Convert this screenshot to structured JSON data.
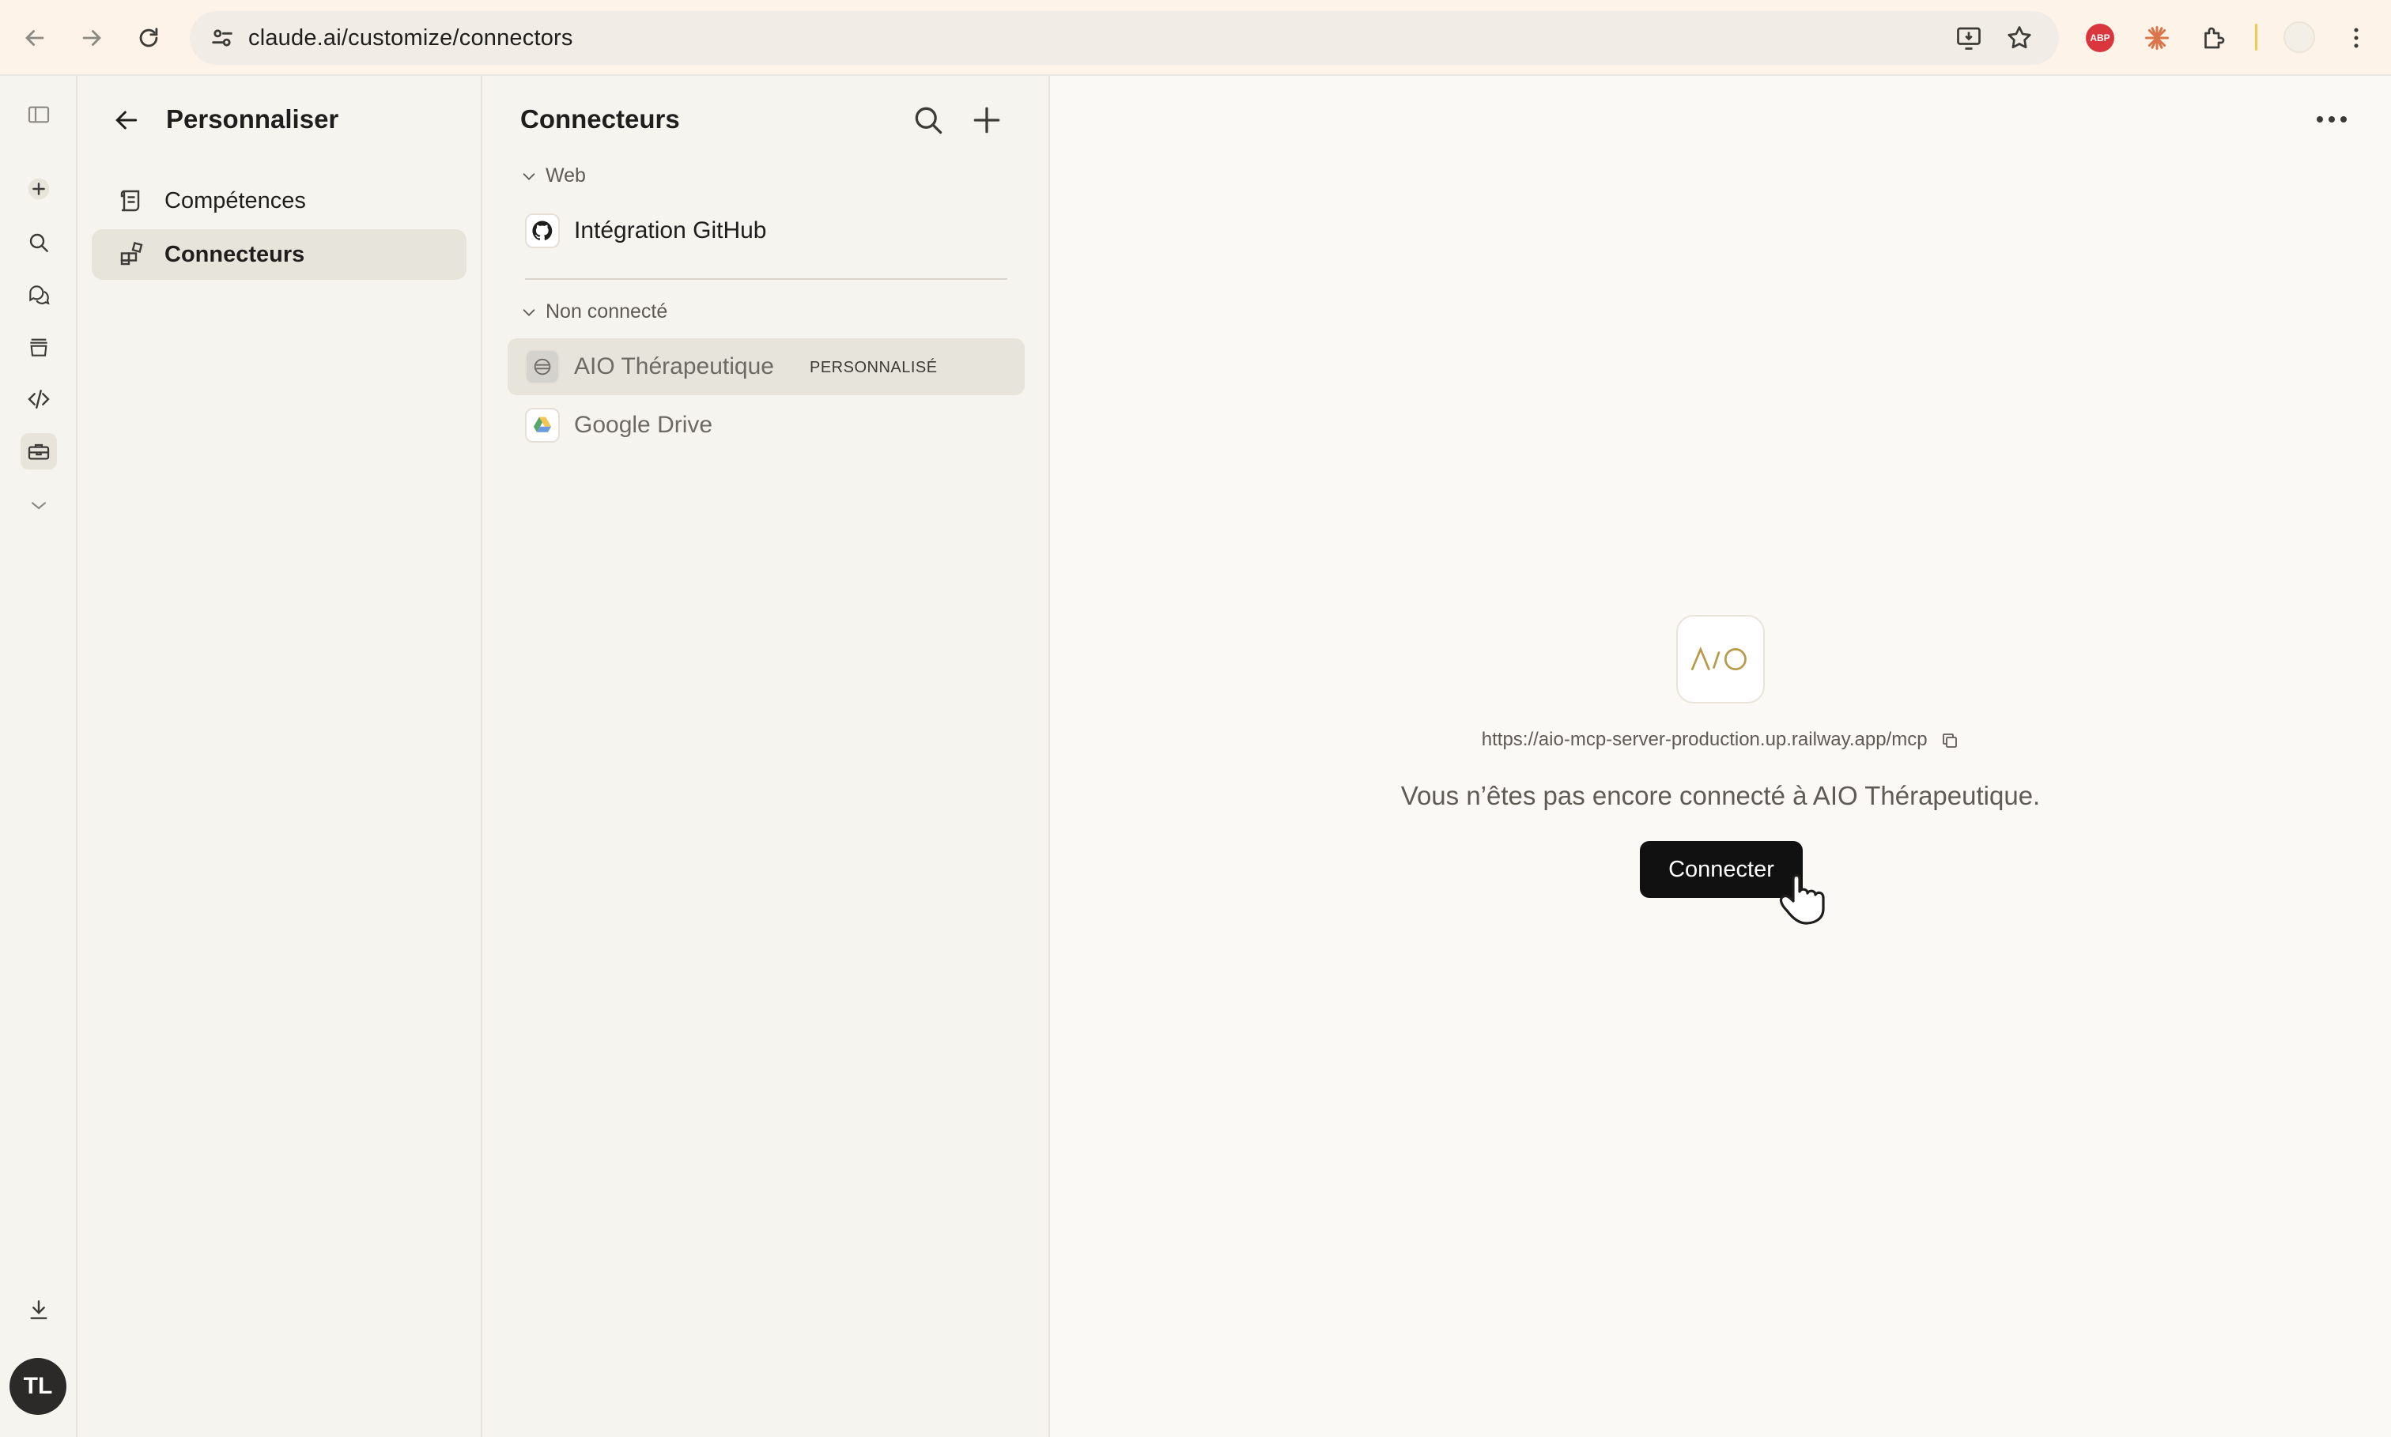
{
  "browser": {
    "url": "claude.ai/customize/connectors",
    "extensions": [
      "abp-icon",
      "claude-icon",
      "puzzle-icon"
    ],
    "abp_label": "ABP"
  },
  "rail": {
    "items": [
      "sidebar-toggle-icon",
      "new-chat-icon",
      "search-icon",
      "chats-icon",
      "projects-icon",
      "code-icon",
      "tools-icon",
      "more-icon",
      "download-icon"
    ],
    "avatar_initials": "TL"
  },
  "customize": {
    "title": "Personnaliser",
    "items": [
      {
        "label": "Compétences",
        "active": false
      },
      {
        "label": "Connecteurs",
        "active": true
      }
    ]
  },
  "connectors": {
    "title": "Connecteurs",
    "groups": [
      {
        "label": "Web",
        "items": [
          {
            "label": "Intégration GitHub",
            "icon": "github-icon"
          }
        ]
      },
      {
        "label": "Non connecté",
        "items": [
          {
            "label": "AIO Thérapeutique",
            "badge": "PERSONNALISÉ",
            "icon": "aio-icon",
            "selected": true
          },
          {
            "label": "Google Drive",
            "icon": "google-drive-icon"
          }
        ]
      }
    ]
  },
  "detail": {
    "endpoint": "https://aio-mcp-server-production.up.railway.app/mcp",
    "message": "Vous n’êtes pas encore connecté à AIO Thérapeutique.",
    "connect_label": "Connecter",
    "logo_text": "AIO"
  },
  "colors": {
    "background": "#faf9f5",
    "panel": "#f5f4ef",
    "selected": "#e7e4dc",
    "button": "#111111",
    "logo_gold": "#b99a4a"
  }
}
